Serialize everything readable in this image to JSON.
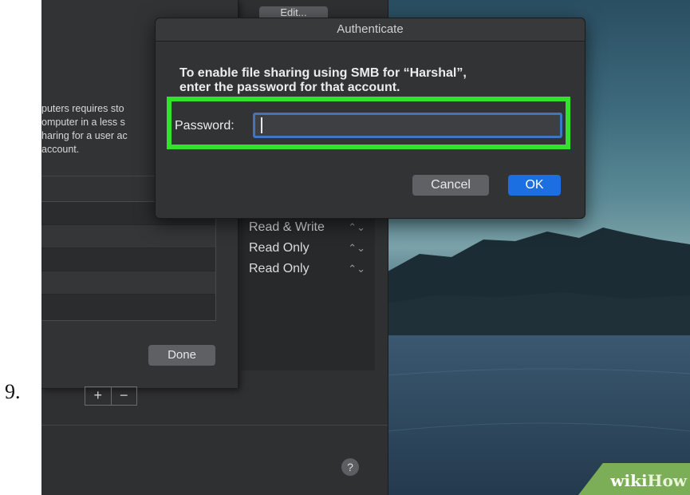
{
  "step_number": "9.",
  "prefs_window": {
    "edit_button_label": "Edit...",
    "info_text_lines": [
      "puters requires sto",
      "omputer in a less s",
      "haring for a user ac",
      "account."
    ],
    "permissions": [
      {
        "label": "Read & Write",
        "arrow": "⌃⌄"
      },
      {
        "label": "Read Only",
        "arrow": "⌃⌄"
      },
      {
        "label": "Read Only",
        "arrow": "⌃⌄"
      }
    ],
    "done_button_label": "Done",
    "add_button_label": "+",
    "remove_button_label": "−",
    "help_button_label": "?"
  },
  "dialog": {
    "title": "Authenticate",
    "message_line1": "To enable file sharing using SMB for “Harshal”,",
    "message_line2": "enter the password for that account.",
    "password_label": "Password:",
    "password_value": "",
    "cancel_label": "Cancel",
    "ok_label": "OK",
    "highlight_color": "#33e22d",
    "ok_color": "#1c6fe0"
  },
  "watermark": {
    "wiki": "wiki",
    "how": "How"
  }
}
